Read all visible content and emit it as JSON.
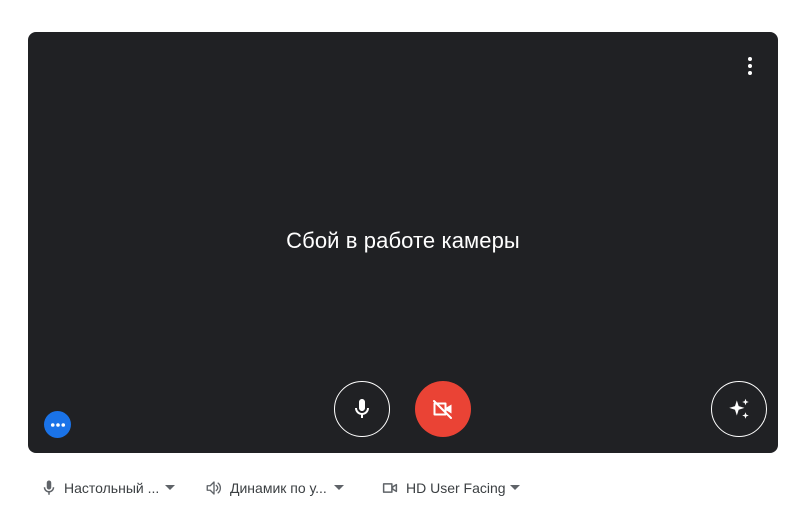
{
  "preview": {
    "status_text": "Сбой в работе камеры",
    "background_color": "#202124",
    "more_options_icon": "more-vert-icon"
  },
  "controls": {
    "mic_icon": "microphone-icon",
    "camera_icon": "videocam-off-icon",
    "camera_off_color": "#ea4335",
    "effects_icon": "sparkle-icon",
    "extra_icon": "more-horiz-icon",
    "extra_color": "#1a73e8"
  },
  "devices": {
    "microphone": {
      "label": "Настольный ...",
      "icon": "microphone-icon"
    },
    "speaker": {
      "label": "Динамик по у...",
      "icon": "speaker-icon"
    },
    "camera": {
      "label": "HD User Facing",
      "icon": "videocam-icon"
    }
  }
}
